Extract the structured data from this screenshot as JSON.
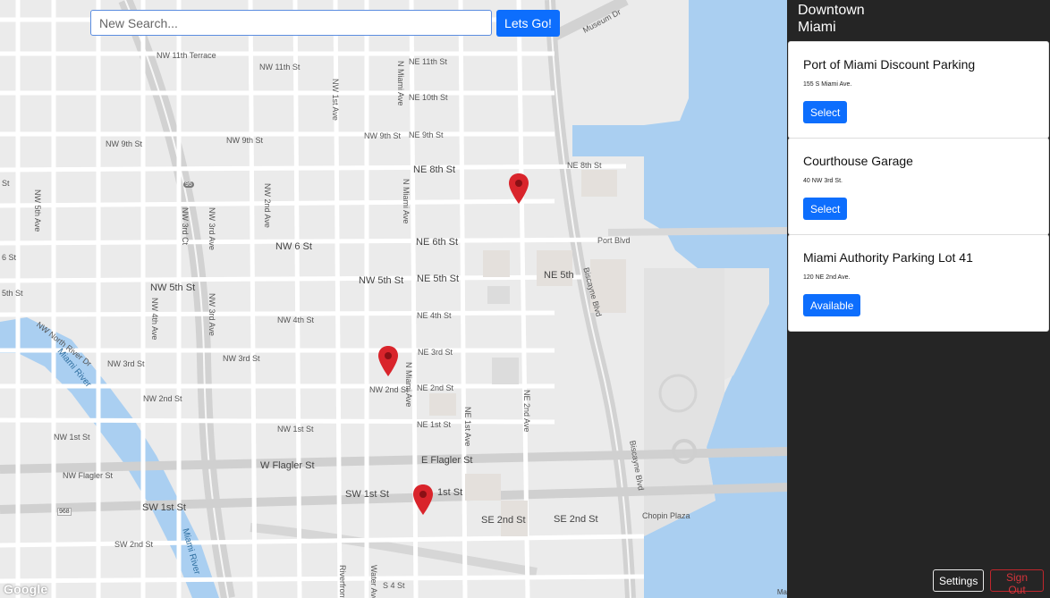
{
  "search": {
    "placeholder": "New Search...",
    "button_label": "Lets Go!"
  },
  "sidebar": {
    "title": "Downtown Miami",
    "cards": [
      {
        "name": "Port of Miami Discount Parking",
        "address": "155 S Miami Ave.",
        "button_label": "Select"
      },
      {
        "name": "Courthouse Garage",
        "address": "40 NW 3rd St.",
        "button_label": "Select"
      },
      {
        "name": "Miami Authority Parking Lot 41",
        "address": "120 NE 2nd Ave.",
        "button_label": "Available"
      }
    ],
    "settings_label": "Settings",
    "signout_label": "Sign Out"
  },
  "map": {
    "logo_text": "Google",
    "attribution": "Ma",
    "pin_color": "#d9242b",
    "water_color": "#a9cef2",
    "labels": {
      "nw11terrace": "NW 11th Terrace",
      "ne11th": "NE 11th St",
      "nw11th": "NW 11th St",
      "ne10th": "NE 10th St",
      "nw9th": "NW 9th St",
      "nw9th_b": "NW 9th St",
      "ne9th": "NE 9th St",
      "ne8th": "NE 8th St",
      "ne8th_b": "NE 8th St",
      "nw6": "NW 6 St",
      "ne6th": "NE 6th St",
      "portblvd": "Port Blvd",
      "nw5th": "NW 5th St",
      "nw5th_b": "NW 5th St",
      "ne5th": "NE 5th St",
      "ne5th_b": "NE 5th",
      "nw4th": "NW 4th St",
      "ne4th": "NE 4th St",
      "nw3rd": "NW 3rd St",
      "nw3rd_b": "NW 3rd St",
      "ne3rd": "NE 3rd St",
      "nw2nd": "NW 2nd St",
      "ne2nd": "NE 2nd St",
      "nw2nd_b": "NW 2nd St",
      "ne1st": "NE 1st St",
      "nw1st": "NW 1st St",
      "nw1st_b": "NW 1st St",
      "wflagler": "W Flagler St",
      "eflagler": "E Flagler St",
      "nwflagler": "NW Flagler St",
      "sw1st": "SW 1st St",
      "sw1st_b": "SW 1st St",
      "e1st": "1st St",
      "se2nd": "SE 2nd St",
      "se2nd_b": "SE 2nd St",
      "sw2nd": "SW 2nd St",
      "chopin": "Chopin Plaza",
      "s4st": "S 4 St",
      "miamiriver": "Miami River",
      "miamiriver_b": "Miami River",
      "nwnorthriver": "NW North River Dr",
      "nmiamiave": "N Miami Ave",
      "nmiamiave_b": "N Miami Ave",
      "ne2ndave": "NE 2nd Ave",
      "ne1stave": "NE 1st Ave",
      "biscayne": "Biscayne Blvd",
      "biscayne_b": "Biscayne Blvd",
      "nw3rdct": "NW 3rd Ct",
      "nw3rdave": "NW 3rd Ave",
      "nw3rdave_b": "NW 3rd Ave",
      "nw2ndave": "NW 2nd Ave",
      "nw1stave": "NW 1st Ave",
      "nw4thave": "NW 4th Ave",
      "nw5thave": "NW 5th Ave",
      "riverfront": "Riverfront",
      "watersave": "Water Ave",
      "i95": "95",
      "hw968": "968",
      "museum": "Museum Dr",
      "st_left1": "St",
      "st_left2": "6 St",
      "st_left3": "5th St"
    }
  }
}
